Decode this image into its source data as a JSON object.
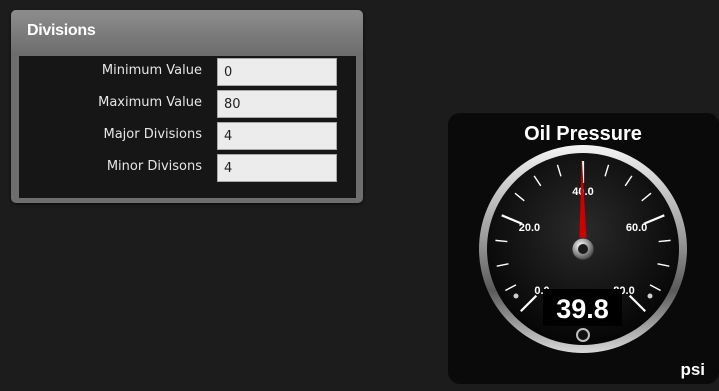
{
  "panel": {
    "title": "Divisions",
    "fields": [
      {
        "label": "Minimum Value",
        "value": "0"
      },
      {
        "label": "Maximum Value",
        "value": "80"
      },
      {
        "label": "Major Divisions",
        "value": "4"
      },
      {
        "label": "Minor Divisons",
        "value": "4"
      }
    ]
  },
  "gauge": {
    "title": "Oil Pressure",
    "unit": "psi",
    "reading": "39.8",
    "value": 39.8,
    "min": 0,
    "max": 80,
    "major_divisions": 4,
    "minor_divisions": 4,
    "tick_labels": [
      "0.0",
      "20.0",
      "40.0",
      "60.0",
      "80.0"
    ],
    "needle_color": "#d00000"
  }
}
